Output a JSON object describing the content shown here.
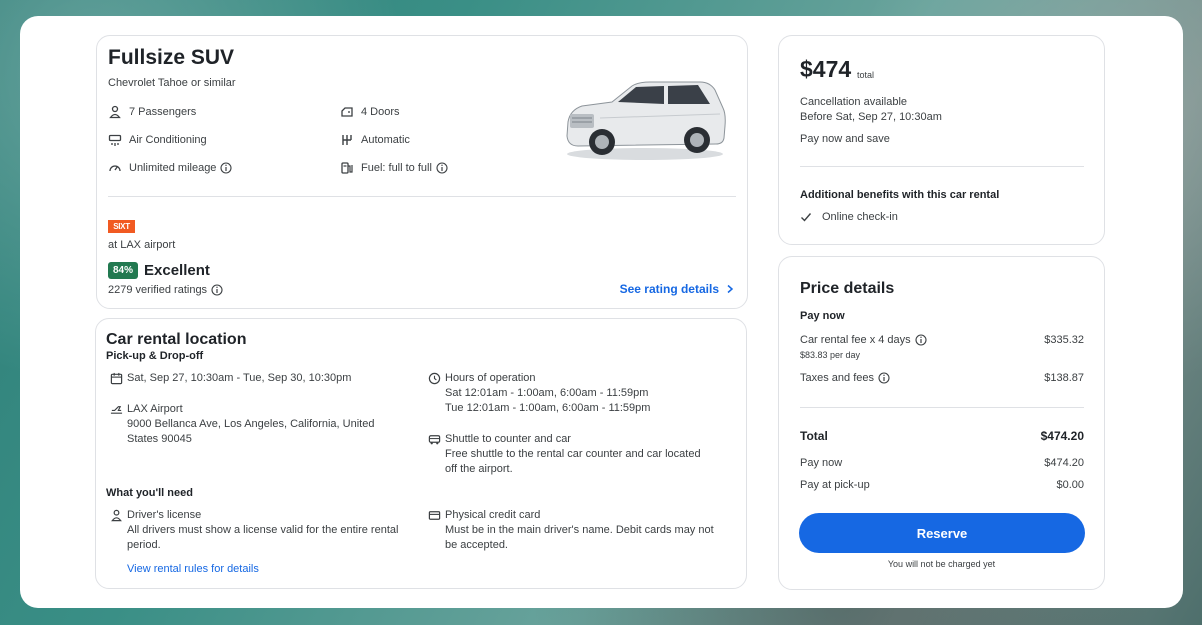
{
  "car": {
    "title": "Fullsize SUV",
    "subtitle": "Chevrolet Tahoe or similar",
    "features": {
      "passengers": "7 Passengers",
      "doors": "4 Doors",
      "ac": "Air Conditioning",
      "transmission": "Automatic",
      "mileage": "Unlimited mileage",
      "fuel": "Fuel: full to full"
    },
    "vendor_logo_text": "SIXT",
    "vendor_location": "at LAX airport",
    "rating_score": "84%",
    "rating_word": "Excellent",
    "verified_ratings": "2279 verified ratings",
    "see_rating_details": "See rating details"
  },
  "location": {
    "title": "Car rental location",
    "subtitle": "Pick-up & Drop-off",
    "dates": "Sat, Sep 27, 10:30am - Tue, Sep 30, 10:30pm",
    "hours_title": "Hours of operation",
    "hours_sat": "Sat 12:01am - 1:00am, 6:00am - 11:59pm",
    "hours_tue": "Tue 12:01am - 1:00am, 6:00am - 11:59pm",
    "airport_name": "LAX Airport",
    "airport_addr1": "9000 Bellanca Ave, Los Angeles, California, United",
    "airport_addr2": "States 90045",
    "shuttle_title": "Shuttle to counter and car",
    "shuttle_line1": "Free shuttle to the rental car counter and car located",
    "shuttle_line2": "off the airport.",
    "need_title": "What you'll need",
    "license_title": "Driver's license",
    "license_line1": "All drivers must show a license valid for the entire rental",
    "license_line2": "period.",
    "card_title": "Physical credit card",
    "card_line1": "Must be in the main driver's name. Debit cards may not",
    "card_line2": "be accepted.",
    "rules_link": "View rental rules for details"
  },
  "summary": {
    "price": "$474",
    "price_label": "total",
    "cancellation": "Cancellation available",
    "cancel_before": "Before Sat, Sep 27, 10:30am",
    "pay_now_save": "Pay now and save",
    "benefits_title": "Additional benefits with this car rental",
    "benefit_1": "Online check-in"
  },
  "price_details": {
    "title": "Price details",
    "pay_now_heading": "Pay now",
    "fee_label": "Car rental fee x 4 days",
    "fee_value": "$335.32",
    "fee_per_day": "$83.83 per day",
    "taxes_label": "Taxes and fees",
    "taxes_value": "$138.87",
    "total_label": "Total",
    "total_value": "$474.20",
    "paynow_label": "Pay now",
    "paynow_value": "$474.20",
    "pickup_label": "Pay at pick-up",
    "pickup_value": "$0.00",
    "reserve_label": "Reserve",
    "not_charged": "You will not be charged yet"
  },
  "colors": {
    "accent": "#1668e3",
    "rating_badge": "#227950",
    "vendor": "#f15a22"
  }
}
